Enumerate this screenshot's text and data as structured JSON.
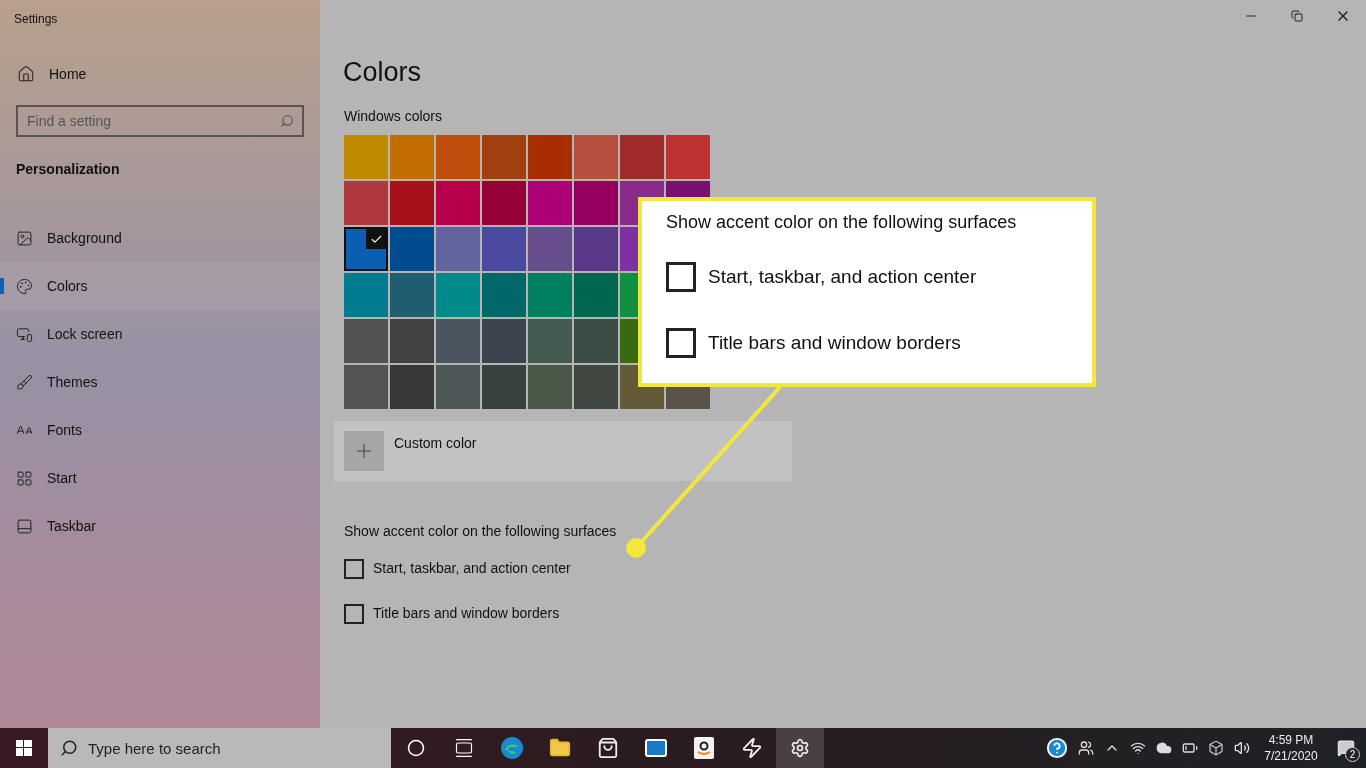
{
  "window": {
    "title": "Settings"
  },
  "sidebar": {
    "home": "Home",
    "search": {
      "placeholder": "Find a setting"
    },
    "section": "Personalization",
    "items": [
      {
        "label": "Background",
        "kind": "background",
        "selected": false
      },
      {
        "label": "Colors",
        "kind": "colors",
        "selected": true
      },
      {
        "label": "Lock screen",
        "kind": "lockscreen",
        "selected": false
      },
      {
        "label": "Themes",
        "kind": "themes",
        "selected": false
      },
      {
        "label": "Fonts",
        "kind": "fonts",
        "selected": false
      },
      {
        "label": "Start",
        "kind": "start",
        "selected": false
      },
      {
        "label": "Taskbar",
        "kind": "taskbar",
        "selected": false
      }
    ]
  },
  "page": {
    "title": "Colors",
    "windows_colors": {
      "label": "Windows colors",
      "swatches": [
        [
          {
            "color": "#c08a00",
            "selected": false
          },
          {
            "color": "#c36c00",
            "selected": false
          },
          {
            "color": "#c04e0b",
            "selected": false
          },
          {
            "color": "#a43f0f",
            "selected": false
          },
          {
            "color": "#a82d00",
            "selected": false
          },
          {
            "color": "#b85040",
            "selected": false
          },
          {
            "color": "#a12a2a",
            "selected": false
          },
          {
            "color": "#c03232",
            "selected": false
          }
        ],
        [
          {
            "color": "#b0383f",
            "selected": false
          },
          {
            "color": "#a8101a",
            "selected": false
          },
          {
            "color": "#b8004a",
            "selected": false
          },
          {
            "color": "#98003a",
            "selected": false
          },
          {
            "color": "#ad0076",
            "selected": false
          },
          {
            "color": "#950060",
            "selected": false
          },
          {
            "color": "#8a2a8a",
            "selected": false
          },
          {
            "color": "#7a1070",
            "selected": false
          }
        ],
        [
          {
            "color": "#0a5fb0",
            "selected": true
          },
          {
            "color": "#004c8e",
            "selected": false
          },
          {
            "color": "#6264a0",
            "selected": false
          },
          {
            "color": "#4a4aa0",
            "selected": false
          },
          {
            "color": "#674d8c",
            "selected": false
          },
          {
            "color": "#5a3a88",
            "selected": false
          },
          {
            "color": "#8030a0",
            "selected": false
          }
        ],
        [
          {
            "color": "#007b8f",
            "selected": false
          },
          {
            "color": "#1f5e70",
            "selected": false
          },
          {
            "color": "#008a8a",
            "selected": false
          },
          {
            "color": "#006868",
            "selected": false
          },
          {
            "color": "#008060",
            "selected": false
          },
          {
            "color": "#006650",
            "selected": false
          },
          {
            "color": "#109040",
            "selected": false
          }
        ],
        [
          {
            "color": "#525252",
            "selected": false
          },
          {
            "color": "#424242",
            "selected": false
          },
          {
            "color": "#4a5560",
            "selected": false
          },
          {
            "color": "#3c4450",
            "selected": false
          },
          {
            "color": "#445a50",
            "selected": false
          },
          {
            "color": "#3a4c44",
            "selected": false
          },
          {
            "color": "#3a6a10",
            "selected": false
          }
        ],
        [
          {
            "color": "#545454",
            "selected": false
          },
          {
            "color": "#383838",
            "selected": false
          },
          {
            "color": "#4e5858",
            "selected": false
          },
          {
            "color": "#384040",
            "selected": false
          },
          {
            "color": "#4a5848",
            "selected": false
          },
          {
            "color": "#404640",
            "selected": false
          },
          {
            "color": "#645a38",
            "selected": false
          },
          {
            "color": "#5a5448",
            "selected": false
          }
        ]
      ]
    },
    "custom_color": "Custom color",
    "surfaces": {
      "heading": "Show accent color on the following surfaces",
      "options": [
        {
          "label": "Start, taskbar, and action center",
          "checked": false
        },
        {
          "label": "Title bars and window borders",
          "checked": false
        }
      ]
    }
  },
  "callout": {
    "heading": "Show accent color on the following surfaces",
    "options": [
      {
        "label": "Start, taskbar, and action center",
        "checked": false
      },
      {
        "label": "Title bars and window borders",
        "checked": false
      }
    ]
  },
  "taskbar": {
    "search": {
      "placeholder": "Type here to search"
    },
    "apps": [
      {
        "kind": "cortana",
        "selected": false
      },
      {
        "kind": "taskview",
        "selected": false
      },
      {
        "kind": "browser",
        "selected": false
      },
      {
        "kind": "folder",
        "selected": false
      },
      {
        "kind": "store",
        "selected": false
      },
      {
        "kind": "mail",
        "selected": false
      },
      {
        "kind": "shop",
        "selected": false
      },
      {
        "kind": "bolt",
        "selected": false
      },
      {
        "kind": "settings",
        "selected": true
      }
    ],
    "tray": [
      {
        "kind": "help"
      },
      {
        "kind": "people"
      },
      {
        "kind": "chevron"
      },
      {
        "kind": "wifi"
      },
      {
        "kind": "cloud"
      },
      {
        "kind": "battery"
      },
      {
        "kind": "dropbox"
      },
      {
        "kind": "volume"
      }
    ],
    "time": "4:59 PM",
    "date": "7/21/2020",
    "notifications": "2"
  }
}
